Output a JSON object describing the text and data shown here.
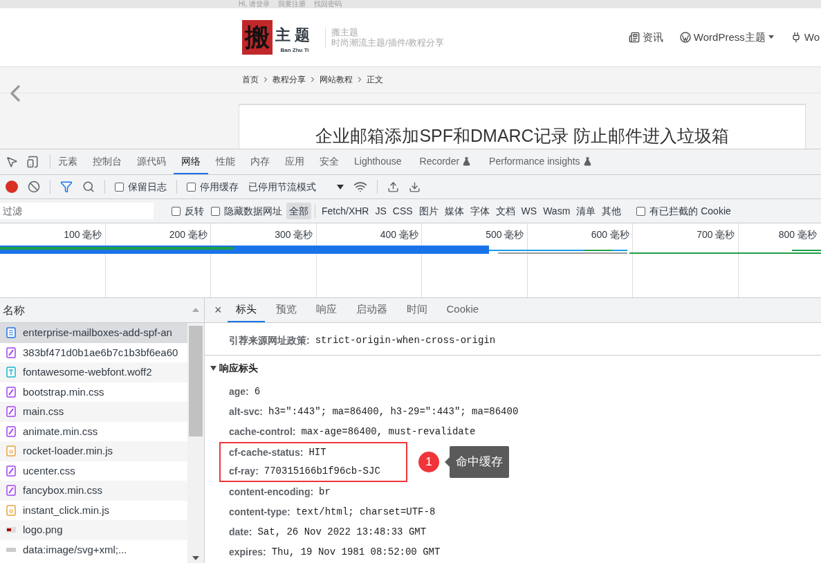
{
  "site": {
    "top_links": [
      "Hi, 请登录",
      "我要注册",
      "找回密码"
    ],
    "logo": {
      "mark": "搬",
      "name": "主题",
      "pinyin": "Ban Zhu Ti"
    },
    "tagline": {
      "title": "搬主题",
      "subtitle": "时尚潮流主题/插件/教程分享"
    },
    "nav": [
      {
        "label": "资讯",
        "kind": "news",
        "dropdown": false
      },
      {
        "label": "WordPress主题",
        "kind": "wordpress",
        "dropdown": true
      },
      {
        "label": "Wo",
        "kind": "plugin",
        "dropdown": false
      }
    ],
    "breadcrumb": [
      "首页",
      "教程分享",
      "网站教程",
      "正文"
    ],
    "article_title": "企业邮箱添加SPF和DMARC记录 防止邮件进入垃圾箱"
  },
  "devtools": {
    "tabs": [
      {
        "label": "元素",
        "selected": false,
        "kind": "plain"
      },
      {
        "label": "控制台",
        "selected": false,
        "kind": "plain"
      },
      {
        "label": "源代码",
        "selected": false,
        "kind": "plain"
      },
      {
        "label": "网络",
        "selected": true,
        "kind": "plain"
      },
      {
        "label": "性能",
        "selected": false,
        "kind": "plain"
      },
      {
        "label": "内存",
        "selected": false,
        "kind": "plain"
      },
      {
        "label": "应用",
        "selected": false,
        "kind": "plain"
      },
      {
        "label": "安全",
        "selected": false,
        "kind": "plain"
      },
      {
        "label": "Lighthouse",
        "selected": false,
        "kind": "plain"
      },
      {
        "label": "Recorder",
        "selected": false,
        "kind": "experimental"
      },
      {
        "label": "Performance insights",
        "selected": false,
        "kind": "experimental"
      }
    ],
    "toolbar": {
      "recording": true,
      "filter_on": true,
      "checkboxes": [
        {
          "label": "保留日志",
          "checked": false
        },
        {
          "label": "停用缓存",
          "checked": false
        }
      ],
      "throttling": "已停用节流模式"
    },
    "filter": {
      "placeholder": "过滤",
      "checkboxes": [
        {
          "label": "反转",
          "checked": false
        },
        {
          "label": "隐藏数据网址",
          "checked": false
        }
      ],
      "types": [
        {
          "label": "全部",
          "selected": true
        },
        {
          "label": "Fetch/XHR",
          "selected": false
        },
        {
          "label": "JS",
          "selected": false
        },
        {
          "label": "CSS",
          "selected": false
        },
        {
          "label": "图片",
          "selected": false
        },
        {
          "label": "媒体",
          "selected": false
        },
        {
          "label": "字体",
          "selected": false
        },
        {
          "label": "文档",
          "selected": false
        },
        {
          "label": "WS",
          "selected": false
        },
        {
          "label": "Wasm",
          "selected": false
        },
        {
          "label": "清单",
          "selected": false
        },
        {
          "label": "其他",
          "selected": false
        }
      ],
      "blocked_cookies": {
        "label": "有已拦截的 Cookie",
        "checked": false
      }
    },
    "timeline": {
      "ticks": [
        "100 毫秒",
        "200 毫秒",
        "300 毫秒",
        "400 毫秒",
        "500 毫秒",
        "600 毫秒",
        "700 毫秒",
        "800 毫秒"
      ]
    },
    "requests": {
      "column": "名称",
      "rows": [
        {
          "name": "enterprise-mailboxes-add-spf-an",
          "kind": "document",
          "selected": true
        },
        {
          "name": "383bf471d0b1ae6b7c1b3bf6ea60",
          "kind": "stylesheet",
          "selected": false
        },
        {
          "name": "fontawesome-webfont.woff2",
          "kind": "font",
          "selected": false
        },
        {
          "name": "bootstrap.min.css",
          "kind": "stylesheet",
          "selected": false
        },
        {
          "name": "main.css",
          "kind": "stylesheet",
          "selected": false
        },
        {
          "name": "animate.min.css",
          "kind": "stylesheet",
          "selected": false
        },
        {
          "name": "rocket-loader.min.js",
          "kind": "script",
          "selected": false
        },
        {
          "name": "ucenter.css",
          "kind": "stylesheet",
          "selected": false
        },
        {
          "name": "fancybox.min.css",
          "kind": "stylesheet",
          "selected": false
        },
        {
          "name": "instant_click.min.js",
          "kind": "script",
          "selected": false
        },
        {
          "name": "logo.png",
          "kind": "image",
          "selected": false
        },
        {
          "name": "data:image/svg+xml;...",
          "kind": "data",
          "selected": false
        }
      ]
    },
    "detail": {
      "close": "×",
      "tabs": [
        {
          "label": "标头",
          "selected": true
        },
        {
          "label": "预览",
          "selected": false
        },
        {
          "label": "响应",
          "selected": false
        },
        {
          "label": "启动器",
          "selected": false
        },
        {
          "label": "时间",
          "selected": false
        },
        {
          "label": "Cookie",
          "selected": false
        }
      ],
      "general": [
        {
          "name": "引荐来源网址政策:",
          "value": "strict-origin-when-cross-origin"
        }
      ],
      "response_headers": {
        "title": "响应标头",
        "expanded": true,
        "headers": [
          {
            "name": "age:",
            "value": "6",
            "highlighted": false
          },
          {
            "name": "alt-svc:",
            "value": "h3=\":443\"; ma=86400, h3-29=\":443\"; ma=86400",
            "highlighted": false
          },
          {
            "name": "cache-control:",
            "value": "max-age=86400, must-revalidate",
            "highlighted": false
          },
          {
            "name": "cf-cache-status:",
            "value": "HIT",
            "highlighted": true
          },
          {
            "name": "cf-ray:",
            "value": "770315166b1f96cb-SJC",
            "highlighted": true
          },
          {
            "name": "content-encoding:",
            "value": "br",
            "highlighted": false
          },
          {
            "name": "content-type:",
            "value": "text/html; charset=UTF-8",
            "highlighted": false
          },
          {
            "name": "date:",
            "value": "Sat, 26 Nov 2022 13:48:33 GMT",
            "highlighted": false
          },
          {
            "name": "expires:",
            "value": "Thu, 19 Nov 1981 08:52:00 GMT",
            "highlighted": false
          }
        ]
      },
      "annotation": {
        "number": "1",
        "text": "命中缓存"
      }
    }
  }
}
